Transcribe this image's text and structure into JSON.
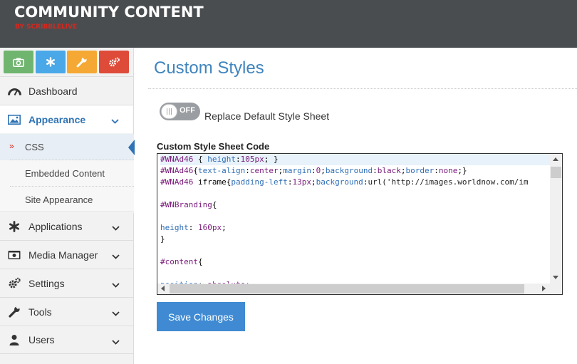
{
  "header": {
    "brand": "COMMUNITY CONTENT",
    "brand_sub": "BY SCRIBBLELIVE"
  },
  "colors": {
    "camera_button": "#6fb56f",
    "asterisk_button": "#4aa8e8",
    "wrench_button": "#f5a833",
    "gears_button": "#de4b39",
    "accent": "#2f73b4",
    "save_button": "#3f8ad2"
  },
  "quick_actions": [
    {
      "icon": "camera-icon"
    },
    {
      "icon": "asterisk-icon"
    },
    {
      "icon": "wrench-icon"
    },
    {
      "icon": "gears-icon"
    }
  ],
  "sidebar": {
    "dashboard": "Dashboard",
    "appearance": "Appearance",
    "appearance_sub": [
      "CSS",
      "Embedded Content",
      "Site Appearance"
    ],
    "applications": "Applications",
    "media_manager": "Media Manager",
    "settings": "Settings",
    "tools": "Tools",
    "users": "Users"
  },
  "main": {
    "title": "Custom Styles",
    "toggle_state": "OFF",
    "toggle_label": "Replace Default Style Sheet",
    "code_label": "Custom Style Sheet Code",
    "save_label": "Save Changes"
  },
  "code_lines": [
    [
      {
        "t": "#WNAd46",
        "c": "sel"
      },
      {
        "t": " { ",
        "c": ""
      },
      {
        "t": "height",
        "c": "prop"
      },
      {
        "t": ":",
        "c": ""
      },
      {
        "t": "105px",
        "c": "num"
      },
      {
        "t": "; }",
        "c": ""
      }
    ],
    [
      {
        "t": "#WNAd46",
        "c": "sel"
      },
      {
        "t": "{",
        "c": ""
      },
      {
        "t": "text-align",
        "c": "prop"
      },
      {
        "t": ":",
        "c": ""
      },
      {
        "t": "center",
        "c": "num"
      },
      {
        "t": ";",
        "c": ""
      },
      {
        "t": "margin",
        "c": "prop"
      },
      {
        "t": ":",
        "c": ""
      },
      {
        "t": "0",
        "c": "num"
      },
      {
        "t": ";",
        "c": ""
      },
      {
        "t": "background",
        "c": "prop"
      },
      {
        "t": ":",
        "c": ""
      },
      {
        "t": "black",
        "c": "num"
      },
      {
        "t": ";",
        "c": ""
      },
      {
        "t": "border",
        "c": "prop"
      },
      {
        "t": ":",
        "c": ""
      },
      {
        "t": "none",
        "c": "num"
      },
      {
        "t": ";}",
        "c": ""
      }
    ],
    [
      {
        "t": "#WNAd46",
        "c": "sel"
      },
      {
        "t": " iframe{",
        "c": ""
      },
      {
        "t": "padding-left",
        "c": "prop"
      },
      {
        "t": ":",
        "c": ""
      },
      {
        "t": "13px",
        "c": "num"
      },
      {
        "t": ";",
        "c": ""
      },
      {
        "t": "background",
        "c": "prop"
      },
      {
        "t": ":",
        "c": ""
      },
      {
        "t": "url('http://images.worldnow.com/im",
        "c": "str"
      }
    ],
    [],
    [
      {
        "t": "#WNBranding",
        "c": "sel"
      },
      {
        "t": "{",
        "c": ""
      }
    ],
    [],
    [
      {
        "t": "height",
        "c": "prop"
      },
      {
        "t": ": ",
        "c": ""
      },
      {
        "t": "160px",
        "c": "num"
      },
      {
        "t": ";",
        "c": ""
      }
    ],
    [
      {
        "t": "}",
        "c": ""
      }
    ],
    [],
    [
      {
        "t": "#content",
        "c": "sel"
      },
      {
        "t": "{",
        "c": ""
      }
    ],
    [],
    [
      {
        "t": "position",
        "c": "prop"
      },
      {
        "t": ": ",
        "c": ""
      },
      {
        "t": "absolute",
        "c": "num"
      },
      {
        "t": ";",
        "c": ""
      }
    ]
  ]
}
